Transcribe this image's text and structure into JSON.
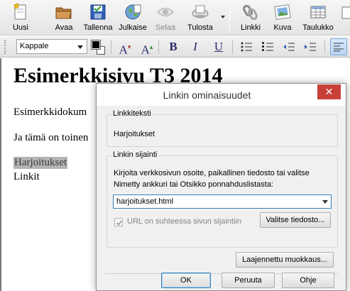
{
  "toolbar": {
    "buttons": [
      {
        "label": "Uusi",
        "icon": "new-document-icon",
        "enabled": true
      },
      {
        "label": "Avaa",
        "icon": "open-folder-icon",
        "enabled": true
      },
      {
        "label": "Tallenna",
        "icon": "save-icon",
        "enabled": true
      },
      {
        "label": "Julkaise",
        "icon": "publish-globe-icon",
        "enabled": true
      },
      {
        "label": "Selaa",
        "icon": "browse-eye-icon",
        "enabled": false
      },
      {
        "label": "Tulosta",
        "icon": "print-icon",
        "enabled": true
      },
      {
        "label": "Linkki",
        "icon": "link-chain-icon",
        "enabled": true
      },
      {
        "label": "Kuva",
        "icon": "image-icon",
        "enabled": true
      },
      {
        "label": "Taulukko",
        "icon": "table-icon",
        "enabled": true
      }
    ]
  },
  "format_bar": {
    "paragraph_style": "Kappale",
    "font_larger": "A",
    "font_smaller": "A",
    "bold": "B",
    "italic": "I",
    "underline": "U"
  },
  "document": {
    "heading": "Esimerkkisivu T3 2014",
    "paragraph1": "Esimerkkidokum",
    "paragraph2": "Ja tämä on toinen",
    "selected_link": "Harjoitukset",
    "paragraph3": "Linkit"
  },
  "dialog": {
    "title": "Linkin ominaisuudet",
    "close_symbol": "✕",
    "link_text_group": "Linkkiteksti",
    "link_text_value": "Harjoitukset",
    "location_group": "Linkin sijainti",
    "location_instructions": "Kirjoita verkkosivun osoite, paikallinen tiedosto tai valitse Nimetty ankkuri tai Otsikko ponnahduslistasta:",
    "url_value": "harjoitukset.html",
    "relative_checkbox_label": "URL on suhteessa sivun sijaintiin",
    "relative_checked": true,
    "choose_file_button": "Valitse tiedosto...",
    "advanced_button": "Laajennettu muokkaus...",
    "ok_button": "OK",
    "cancel_button": "Peruuta",
    "help_button": "Ohje"
  },
  "colors": {
    "close_button": "#c8403a",
    "selection": "#b4b4b4",
    "focus_border": "#3c7fb1"
  }
}
